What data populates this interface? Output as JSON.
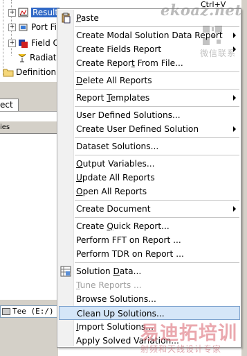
{
  "tree": {
    "items": [
      {
        "label": "Result",
        "selected": true,
        "icon": "results-icon"
      },
      {
        "label": "Port Fi",
        "icon": "port-field-icon"
      },
      {
        "label": "Field O",
        "icon": "field-overlays-icon"
      },
      {
        "label": "Radiat",
        "icon": "radiation-icon"
      },
      {
        "label": "Definition",
        "icon": "folder-icon"
      }
    ]
  },
  "panel": {
    "tab_label": "ect",
    "header_label": "ies"
  },
  "status": {
    "drive_label": "Tee (E:/)"
  },
  "hint_text": "Ctrl+V",
  "menu": {
    "groups": [
      [
        {
          "label": "Paste",
          "ul": 0,
          "icon": "paste-icon"
        }
      ],
      [
        {
          "label": "Create Modal Solution Data Report",
          "ul": -1,
          "submenu": true
        },
        {
          "label": "Create Fields Report",
          "ul": -1,
          "submenu": true
        },
        {
          "label": "Create Report From File...",
          "ul": 12
        }
      ],
      [
        {
          "label": "Delete All Reports",
          "ul": 0
        }
      ],
      [
        {
          "label": "Report Templates",
          "ul": 7,
          "submenu": true
        }
      ],
      [
        {
          "label": "User Defined Solutions...",
          "ul": -1
        },
        {
          "label": "Create User Defined Solution",
          "ul": -1,
          "submenu": true
        }
      ],
      [
        {
          "label": "Dataset Solutions...",
          "ul": -1
        }
      ],
      [
        {
          "label": "Output Variables...",
          "ul": 0
        },
        {
          "label": "Update All Reports",
          "ul": 0
        },
        {
          "label": "Open All Reports",
          "ul": 0
        }
      ],
      [
        {
          "label": "Create Document",
          "ul": -1,
          "submenu": true
        }
      ],
      [
        {
          "label": "Create Quick Report...",
          "ul": 7
        },
        {
          "label": "Perform FFT on Report ...",
          "ul": -1
        },
        {
          "label": "Perform TDR on Report ...",
          "ul": -1
        }
      ],
      [
        {
          "label": "Solution Data...",
          "ul": 9,
          "icon": "solution-data-icon"
        },
        {
          "label": "Tune Reports ...",
          "ul": 0,
          "disabled": true
        },
        {
          "label": "Browse Solutions...",
          "ul": -1
        },
        {
          "label": "Clean Up Solutions...",
          "ul": -1,
          "highlight": true
        },
        {
          "label": "Import Solutions...",
          "ul": 0
        },
        {
          "label": "Apply Solved Variation...",
          "ul": -1
        }
      ]
    ]
  },
  "watermark": {
    "top": "ekoaz.net",
    "cn_small": "微信联系",
    "cn_big": "易迪拓培训",
    "cn_sub": "射频和天线设计专家"
  },
  "colors": {
    "selection": "#3169c6",
    "menu_highlight_bg": "#d5e6f8",
    "menu_highlight_border": "#7da2ce",
    "disabled_text": "#a0a0a0",
    "chrome": "#d4d0c8"
  }
}
